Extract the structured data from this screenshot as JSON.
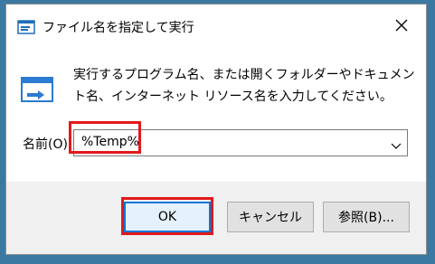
{
  "title": "ファイル名を指定して実行",
  "description": "実行するプログラム名、または開くフォルダーやドキュメント名、インターネット リソース名を入力してください。",
  "name_label": "名前(O):",
  "input_value": "%Temp%",
  "buttons": {
    "ok": "OK",
    "cancel": "キャンセル",
    "browse": "参照(B)..."
  },
  "colors": {
    "highlight": "#e0191b",
    "desktop": "#3b79a3",
    "accent": "#0078d7"
  }
}
